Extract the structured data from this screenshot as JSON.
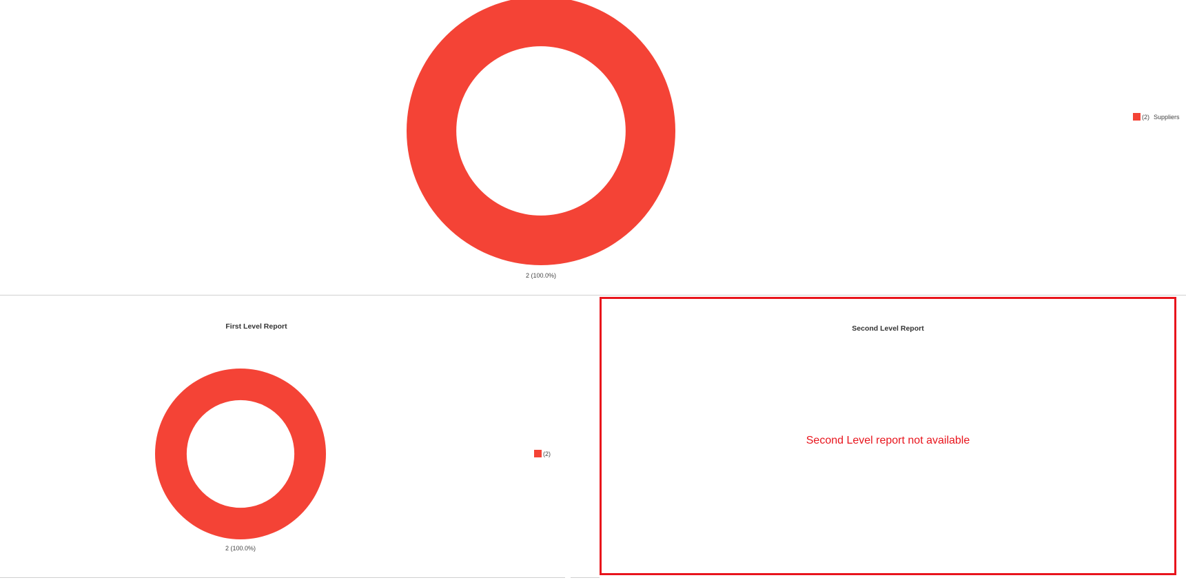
{
  "colors": {
    "slice": "#f44336",
    "alert": "#e8141c"
  },
  "chart_data": [
    {
      "type": "pie",
      "donut": true,
      "slices": [
        {
          "label": "Suppliers",
          "value": 2,
          "display": "2 (100.0%)"
        }
      ],
      "legend": {
        "placement": "right",
        "entries": [
          {
            "count": "(2)",
            "name": "Suppliers"
          }
        ]
      },
      "title": ""
    },
    {
      "type": "pie",
      "donut": true,
      "slices": [
        {
          "label": "",
          "value": 2,
          "display": "2 (100.0%)"
        }
      ],
      "legend": {
        "placement": "right",
        "entries": [
          {
            "count": "(2)",
            "name": ""
          }
        ]
      },
      "title": "First Level Report"
    }
  ],
  "second_level": {
    "title": "Second Level Report",
    "message": "Second Level report not available"
  }
}
